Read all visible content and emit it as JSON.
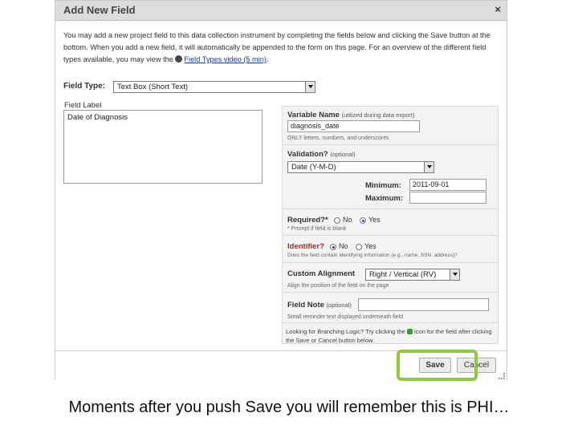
{
  "dialog": {
    "title": "Add New Field",
    "close_label": "×",
    "intro_text": "You may add a new project field to this data collection instrument by completing the fields below and clicking the Save button at the bottom. When you add a new field, it will automatically be appended to the form on this page. For an overview of the different field types available, you may view the ",
    "intro_link": "Field Types video (5 min)",
    "intro_end": ".",
    "video_icon": "film-icon"
  },
  "field_type": {
    "label": "Field Type:",
    "value": "Text Box (Short Text)"
  },
  "field_label": {
    "label": "Field Label",
    "value": "Date of Diagnosis"
  },
  "variable_name": {
    "label": "Variable Name",
    "note": "(utilized during data export)",
    "value": "diagnosis_date",
    "hint": "ONLY letters, numbers, and underscores"
  },
  "validation": {
    "label": "Validation?",
    "note": "(optional)",
    "value": "Date (Y-M-D)",
    "minimum_label": "Minimum:",
    "minimum_value": "2011-09-01",
    "maximum_label": "Maximum:",
    "maximum_value": ""
  },
  "required": {
    "label": "Required?*",
    "options": [
      "No",
      "Yes"
    ],
    "selected": "Yes",
    "hint": "* Prompt if field is blank"
  },
  "identifier": {
    "label": "Identifier?",
    "options": [
      "No",
      "Yes"
    ],
    "selected": "No",
    "hint": "Does the field contain identifying information (e.g., name, SSN, address)?"
  },
  "alignment": {
    "label": "Custom Alignment",
    "value": "Right / Vertical (RV)",
    "hint": "Align the position of the field on the page"
  },
  "field_note": {
    "label": "Field Note",
    "note": "(optional)",
    "value": "",
    "hint": "Small reminder text displayed underneath field"
  },
  "branching_note": {
    "before": "Looking for Branching Logic? Try clicking the ",
    "after": " icon for the field after clicking the Save or Cancel button below.",
    "icon": "branching-icon"
  },
  "buttons": {
    "save": "Save",
    "cancel": "Cancel"
  },
  "colors": {
    "highlight": "#94c83c",
    "link": "#1f3a93"
  },
  "caption": "Moments after you push Save you will remember this is PHI…"
}
